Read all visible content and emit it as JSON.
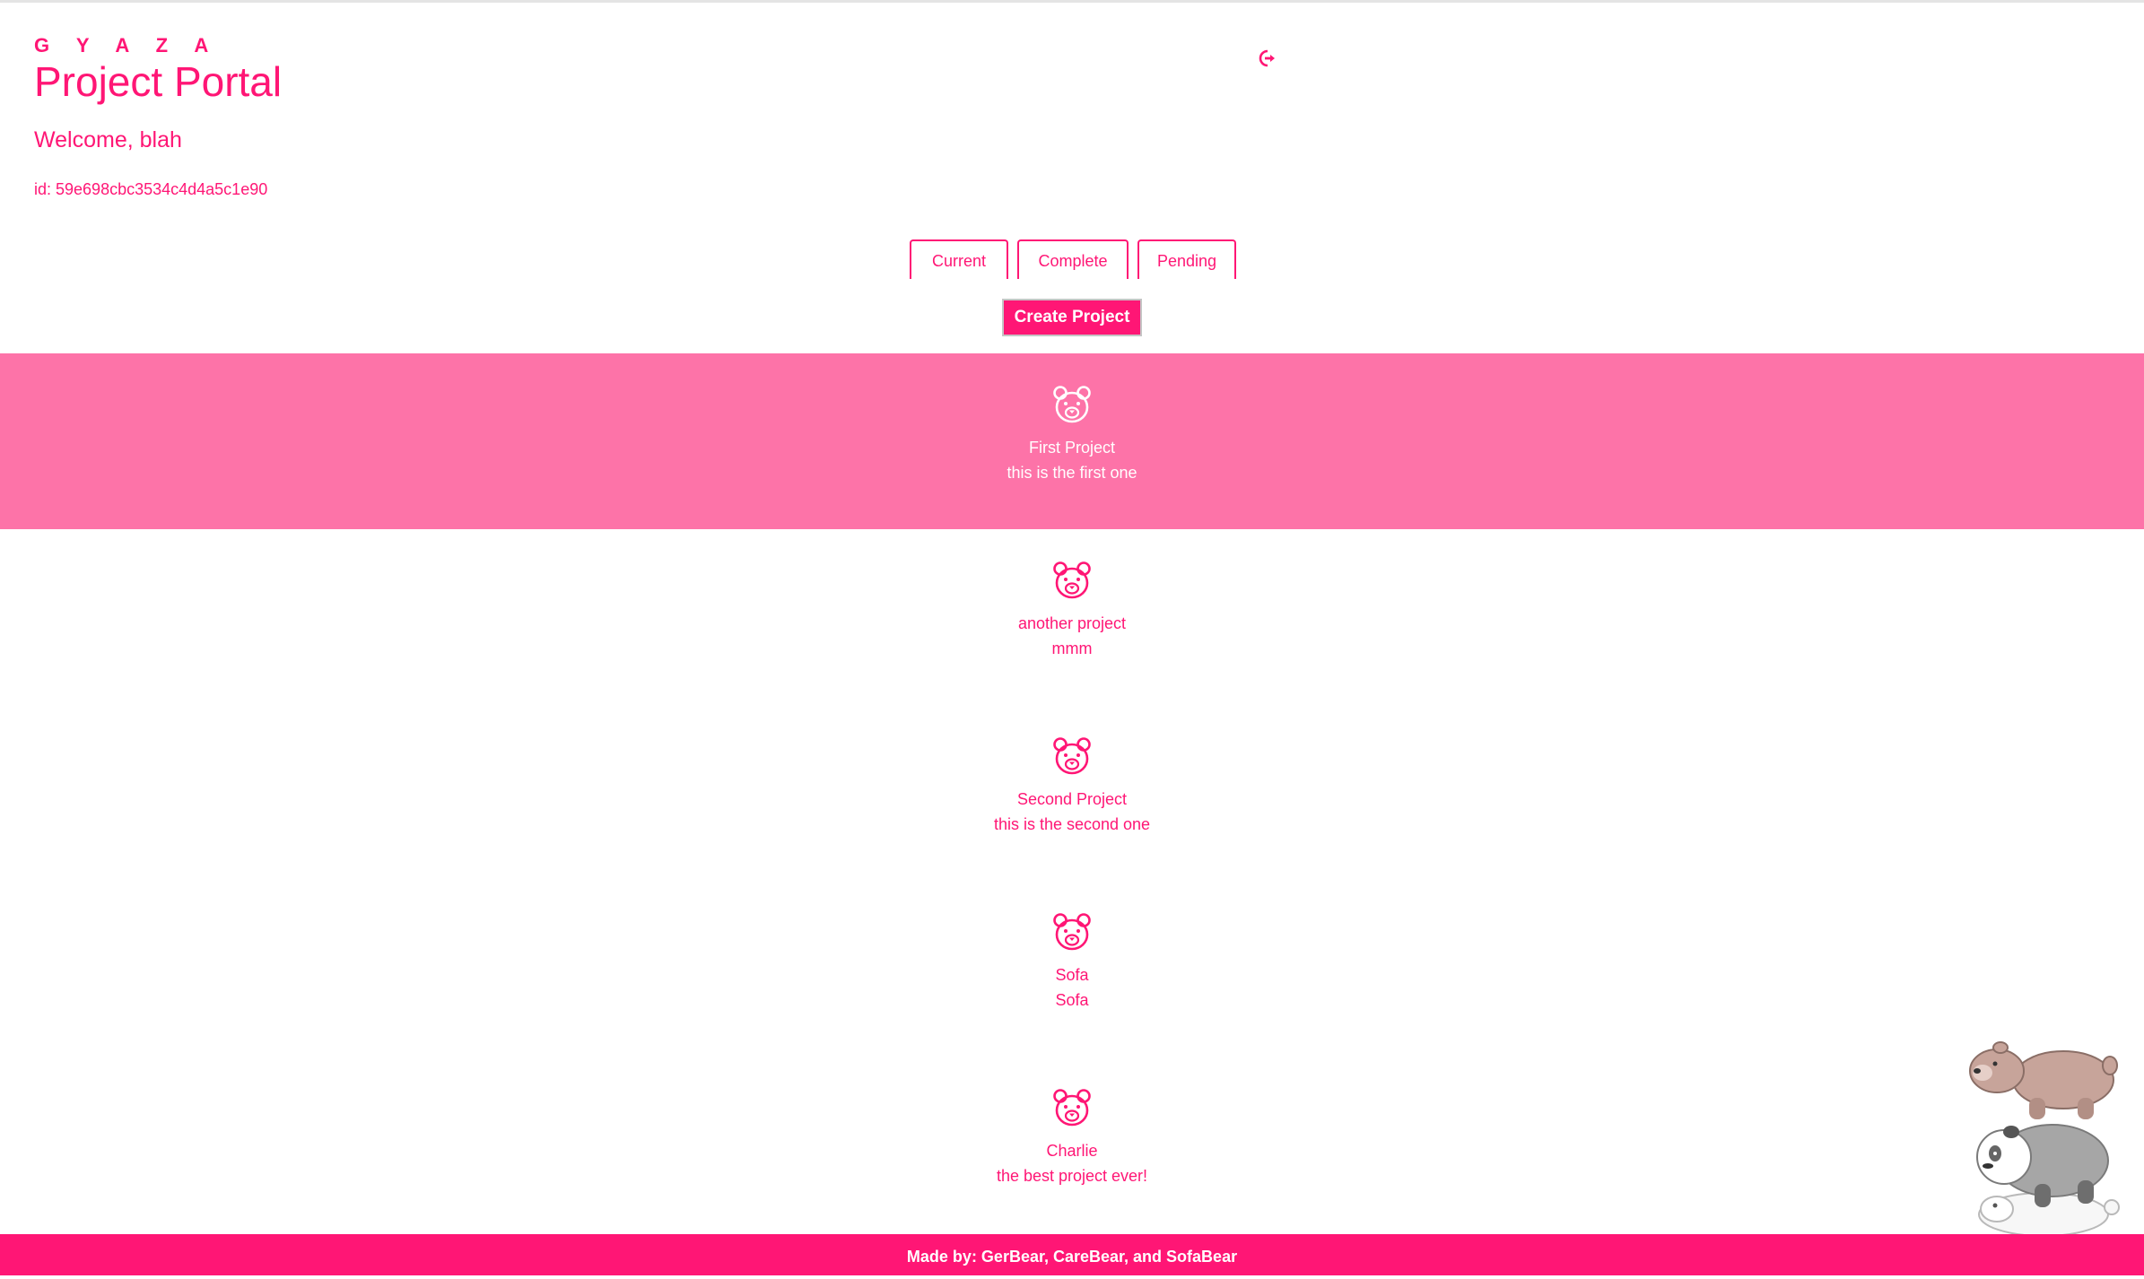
{
  "header": {
    "brand": "G Y A Z A",
    "title": "Project Portal",
    "welcome": "Welcome, blah",
    "user_id": "id: 59e698cbc3534c4d4a5c1e90",
    "logout_icon": "sign-out-icon"
  },
  "tabs": [
    {
      "label": "Current"
    },
    {
      "label": "Complete"
    },
    {
      "label": "Pending"
    }
  ],
  "create_button": "Create Project",
  "projects": [
    {
      "name": "First Project",
      "description": "this is the first one",
      "icon": "bear-icon",
      "selected": true
    },
    {
      "name": "another project",
      "description": "mmm",
      "icon": "bear-icon",
      "selected": false
    },
    {
      "name": "Second Project",
      "description": "this is the second one",
      "icon": "bear-icon",
      "selected": false
    },
    {
      "name": "Sofa",
      "description": "Sofa",
      "icon": "bear-icon",
      "selected": false
    },
    {
      "name": "Charlie",
      "description": "the best project ever!",
      "icon": "bear-icon",
      "selected": false
    }
  ],
  "footer": "Made by: GerBear, CareBear, and SofaBear",
  "colors": {
    "accent": "#ff1675",
    "selected_row": "#fd73a8",
    "footer": "#ff1675"
  }
}
